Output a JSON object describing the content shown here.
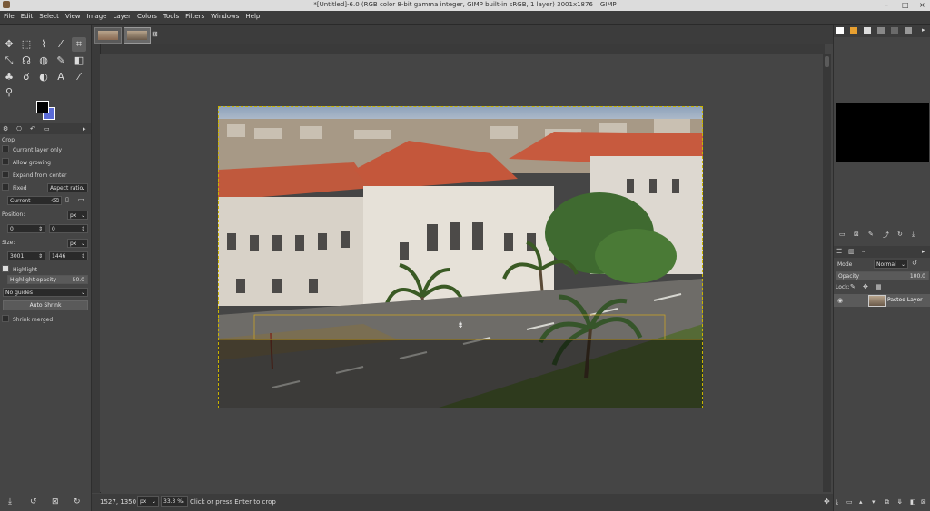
{
  "window": {
    "title": "*[Untitled]-6.0 (RGB color 8-bit gamma integer, GIMP built-in sRGB, 1 layer) 3001x1876 – GIMP",
    "minimize": "–",
    "maximize": "□",
    "close": "×"
  },
  "menu": [
    "File",
    "Edit",
    "Select",
    "View",
    "Image",
    "Layer",
    "Colors",
    "Tools",
    "Filters",
    "Windows",
    "Help"
  ],
  "tool_options": {
    "tool_name": "Crop",
    "current_layer_only": "Current layer only",
    "allow_growing": "Allow growing",
    "expand_from_center": "Expand from center",
    "fixed_label": "Fixed",
    "fixed_value": "Aspect ratio",
    "preset_value": "Current",
    "position_label": "Position:",
    "position_unit": "px",
    "position_x": "0",
    "position_y": "0",
    "size_label": "Size:",
    "size_unit": "px",
    "size_w": "3001",
    "size_h": "1446",
    "highlight_label": "Highlight",
    "highlight_opacity_label": "Highlight opacity",
    "highlight_opacity_value": "50.0",
    "guides_value": "No guides",
    "auto_shrink": "Auto Shrink",
    "shrink_merged": "Shrink merged"
  },
  "status": {
    "coords": "1527, 1350",
    "unit": "px",
    "zoom": "33.3 %",
    "message": "Click or press Enter to crop"
  },
  "layers": {
    "mode_label": "Mode",
    "mode_value": "Normal",
    "opacity_label": "Opacity",
    "opacity_value": "100.0",
    "lock_label": "Lock:",
    "items": [
      {
        "name": "Pasted Layer"
      }
    ]
  },
  "colors": {
    "accent": "#4a6fd6",
    "crop_line": "#c9a227"
  }
}
